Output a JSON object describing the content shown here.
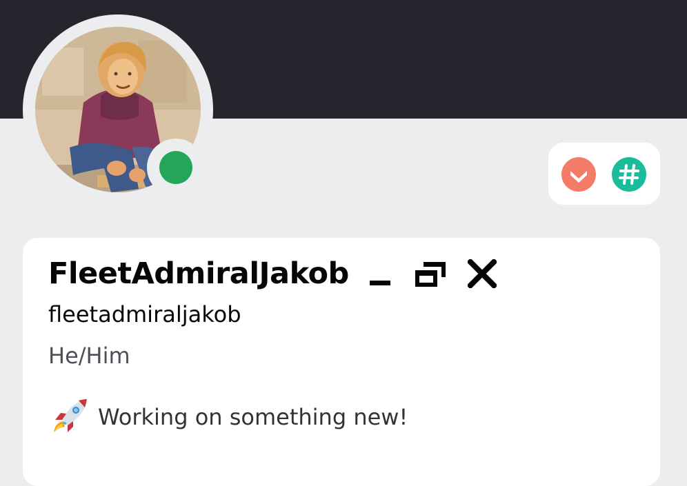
{
  "profile": {
    "display_name": "FleetAdmiralJakob",
    "username": "fleetadmiraljakob",
    "pronouns": "He/Him",
    "custom_status": {
      "emoji": "rocket-icon",
      "text": "Working on something new!"
    },
    "online_status": "online"
  },
  "window_controls": {
    "minimize_icon": "minimize-icon",
    "restore_icon": "restore-icon",
    "close_icon": "close-icon"
  },
  "badges": [
    {
      "icon": "chevron-down-badge-icon",
      "color": "#f47b67"
    },
    {
      "icon": "hashtag-badge-icon",
      "color": "#1abc9c"
    }
  ],
  "colors": {
    "banner": "#26252e",
    "background": "#ebedef",
    "card": "#ffffff",
    "online": "#23a55a"
  }
}
